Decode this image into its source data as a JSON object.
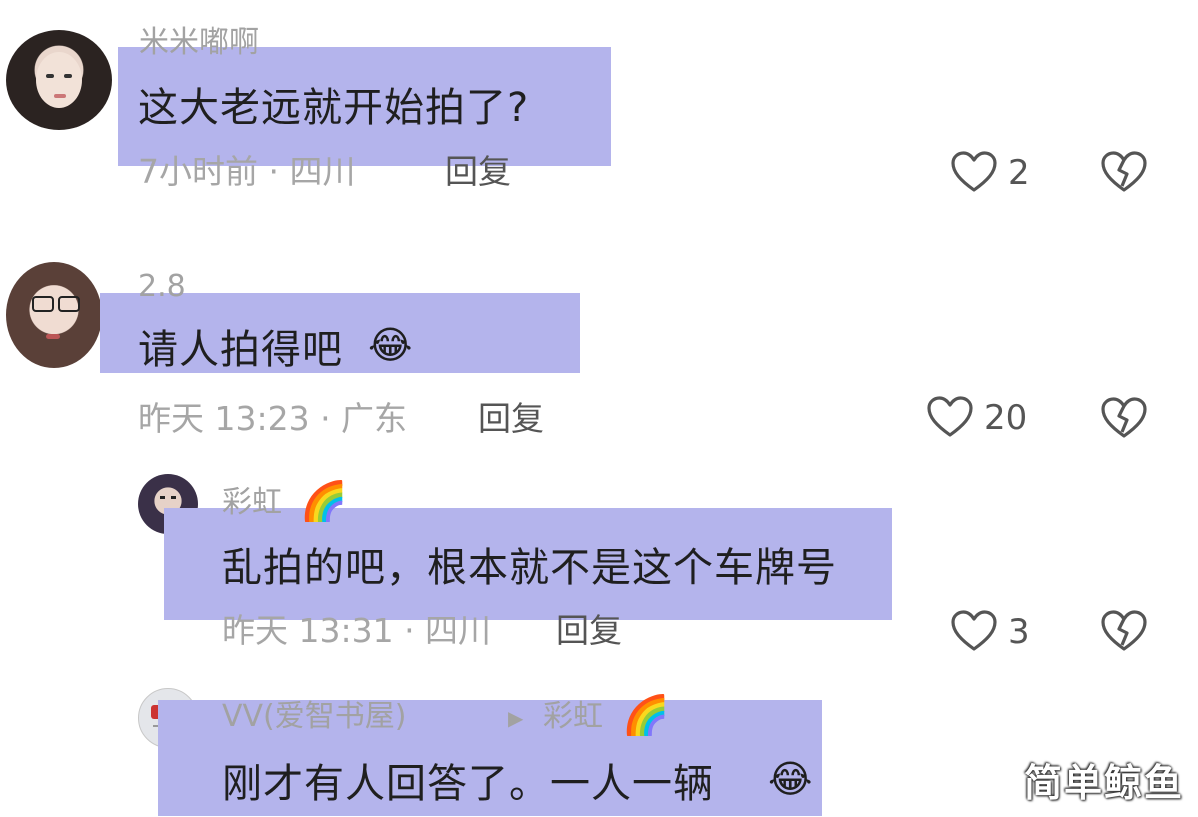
{
  "comments": [
    {
      "username": "米米嘟啊",
      "text": "这大老远就开始拍了?",
      "meta": "7小时前 · 四川",
      "reply_label": "回复",
      "likes": "2"
    },
    {
      "username": "2.8",
      "text": "请人拍得吧",
      "emoji": "😂",
      "meta": "昨天 13:23 · 广东",
      "reply_label": "回复",
      "likes": "20"
    },
    {
      "username": "彩虹",
      "username_emoji": "🌈",
      "text": "乱拍的吧，根本就不是这个车牌号",
      "meta": "昨天 13:31 · 四川",
      "reply_label": "回复",
      "likes": "3"
    },
    {
      "username": "VV(爱智书屋)",
      "reply_arrow": "▶",
      "reply_to": "彩虹",
      "reply_to_emoji": "🌈",
      "text": "刚才有人回答了。一人一辆",
      "emoji": "😂"
    }
  ],
  "watermark": "简单鲸鱼",
  "colors": {
    "highlight": "#b4b4ec",
    "meta_text": "#a6a6a6",
    "icon": "#555555"
  },
  "icons": {
    "like": "heart-outline-icon",
    "dislike": "broken-heart-icon"
  }
}
